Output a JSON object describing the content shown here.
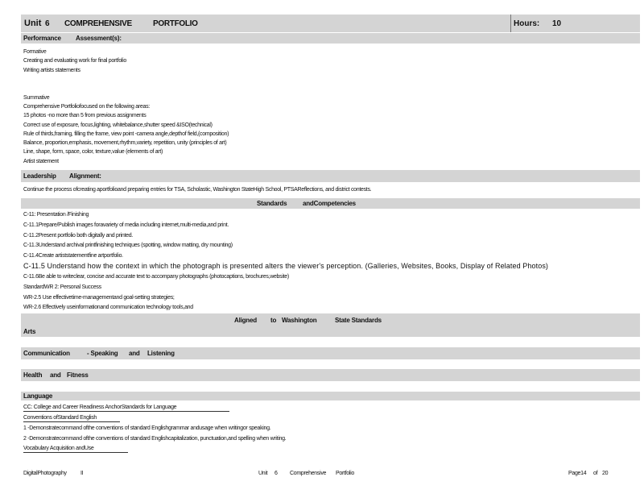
{
  "header": {
    "unit": "Unit",
    "unit_number": "6",
    "unit_title_1": "COMPREHENSIVE",
    "unit_title_2": "PORTFOLIO",
    "hours_label": "Hours:",
    "hours_value": "10"
  },
  "performance": {
    "label": "Performance",
    "label2": "Assessment(s):",
    "formative_lines": [
      "Formative",
      "Creating      and     evaluating       work     for    final     portfolio",
      "Writing    artists    statements"
    ],
    "summative_lines": [
      "Summative",
      "Comprehensive           Portfoliofocused            on     the     following      areas:",
      "15   photos     -no    more     than     5   from     previous        assignments",
      "Correct     use    of   exposure,          focus,lighting,          whitebalance,shutter                  speed      &ISO(technical)",
      "Rule   of   thirds,framing,           filling      the    frame,     view    point    -camera        angle,depthof            field,(composition)",
      "Balance,        proportion,emphasis,                movement,rhythm,variety,                   repetition,        unity    (principles          of   art)",
      "Line,    shape,      form,     space,       color,     texture,value          (elements           of  art)",
      "Artist   statement"
    ]
  },
  "leadership": {
    "label": "Leadership",
    "label2": "Alignment:",
    "text": "Continue       the    process      ofcreating       aportfolioand          preparing         entries     for    TSA,     Scholastic,          Washington         StateHigh         School,      PTSAReflections,             and    district     contests."
  },
  "standards": {
    "title_1": "Standards",
    "title_2": "andCompetencies",
    "lines": [
      "C-11:      Presentation           /Finishing",
      "C-11.1Prepare/Publish                images          foravariety          of    media      including         internet,multi-media,and                   print.",
      "C-11.2Present          portfolio        both       digitally      and     printed.",
      "C-11.3Understand               archival       printfinishing          techniques          (spotting,          window      matting,      dry   mounting)",
      "C-11.4Create          artiststatementfine             artportfolio."
    ],
    "highlight": "C-11.5 Understand how the context in which the photograph is presented alters the viewer's perception. (Galleries, Websites, Books, Display of Related Photos)",
    "lines2": [
      "C-11.6Be       able    to   writeclear,         concise        and      accurate        text   to   accompany          photographs           (photocaptions,                brochures,website)",
      "StandardWR            2:    Personal      Success",
      "WR-2.5     Use     effectivetime-managementand                      goal-setting         strategies;",
      "WR-2.6     Effectively      useinformationand              communication            technology         tools,and"
    ]
  },
  "washington": {
    "aligned": "Aligned",
    "to": "to",
    "washington": "Washington",
    "state_standards": "State Standards",
    "arts": "Arts",
    "communication": "Communication",
    "speaking": "- Speaking",
    "and": "and",
    "listening": "Listening",
    "health": "Health",
    "health_and": "and",
    "fitness": "Fitness",
    "language": "Language"
  },
  "language": {
    "cc_line": "CC:    College         and     Career       Readiness         AnchorStandards             for    Language",
    "conventions": "Conventions          ofStandard         English",
    "line1": "1  -Demonstratecommand                    ofthe     conventions         of   standard      Englishgrammar              andusage        when      writingor       speaking.",
    "line2": "2  -Demonstratecommand                    ofthe     conventions         of   standard      Englishcapitalization,                punctuation,and              spelling       when      writing.",
    "vocab": "Vocabulary        Acquisition           andUse"
  },
  "footer": {
    "left_1": "DigitalPhotography",
    "left_2": "II",
    "center_1": "Unit",
    "center_2": "6",
    "center_3": "Comprehensive",
    "center_4": "Portfolio",
    "page": "Page14",
    "of": "of",
    "total": "20"
  }
}
